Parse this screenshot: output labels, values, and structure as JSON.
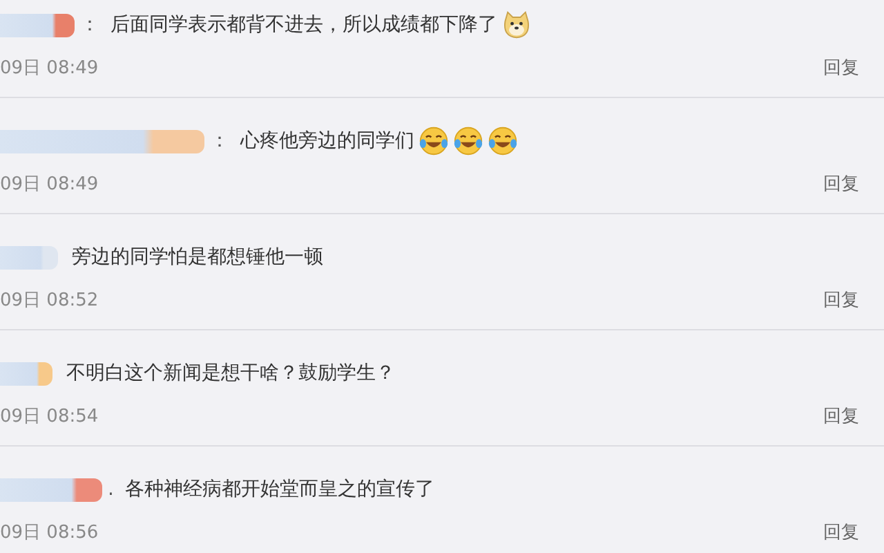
{
  "comments": [
    {
      "color": "#e8806a",
      "separator": "：",
      "text": "后面同学表示都背不进去，所以成绩都下降了",
      "emojis": [
        {
          "kind": "doge"
        }
      ],
      "time": "09日 08:49",
      "reply": "回复"
    },
    {
      "color": "#f5c9a0",
      "separator": "：",
      "text": "心疼他旁边的同学们",
      "emojis": [
        {
          "kind": "laugh-cry"
        },
        {
          "kind": "laugh-cry"
        },
        {
          "kind": "laugh-cry"
        }
      ],
      "time": "09日 08:49",
      "reply": "回复"
    },
    {
      "color": "#dfe6f0",
      "text": "旁边的同学怕是都想锤他一顿",
      "time": "09日 08:52",
      "reply": "回复"
    },
    {
      "color": "#f7c98a",
      "text": "不明白这个新闻是想干啥？鼓励学生？",
      "time": "09日 08:54",
      "reply": "回复"
    },
    {
      "color": "#ec8b7a",
      "separator": ".",
      "text": "各种神经病都开始堂而皇之的宣传了",
      "time": "09日 08:56",
      "reply": "回复"
    }
  ]
}
